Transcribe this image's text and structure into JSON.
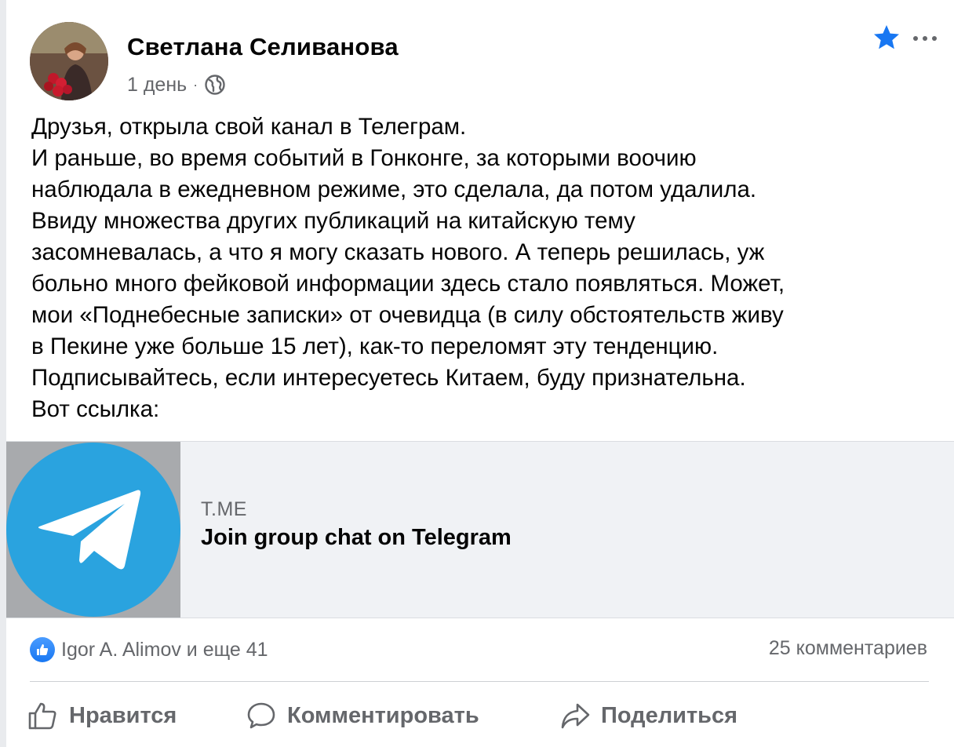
{
  "post": {
    "author": "Светлана Селиванова",
    "time": "1 день",
    "separator": "·",
    "audience_icon": "globe-icon",
    "favorite_icon": "star-icon",
    "more_icon": "more-icon",
    "text_lines": [
      "Друзья, открыла свой канал в Телеграм.",
      "И раньше, во время событий в Гонконге, за которыми воочию",
      "наблюдала в ежедневном режиме, это сделала, да потом удалила.",
      "Ввиду множества других публикаций на китайскую тему",
      "засомневалась, а что я могу сказать нового. А теперь решилась, уж",
      "больно много фейковой информации здесь стало появляться.  Может,",
      "мои «Поднебесные записки» от очевидца (в силу обстоятельств живу",
      "в Пекине уже больше 15 лет), как-то переломят эту тенденцию.",
      "Подписывайтесь, если интересуетесь Китаем, буду признательна.",
      "Вот ссылка:"
    ]
  },
  "link_preview": {
    "domain": "T.ME",
    "title": "Join group chat on Telegram",
    "thumbnail_icon": "telegram-logo-icon",
    "brand_color": "#2aa3df"
  },
  "engagement": {
    "reactions_text": "Igor A. Alimov и еще 41",
    "comments_text": "25 комментариев"
  },
  "actions": {
    "like": "Нравится",
    "comment": "Комментировать",
    "share": "Поделиться"
  },
  "colors": {
    "accent": "#1877f2",
    "secondary_text": "#65676b"
  }
}
